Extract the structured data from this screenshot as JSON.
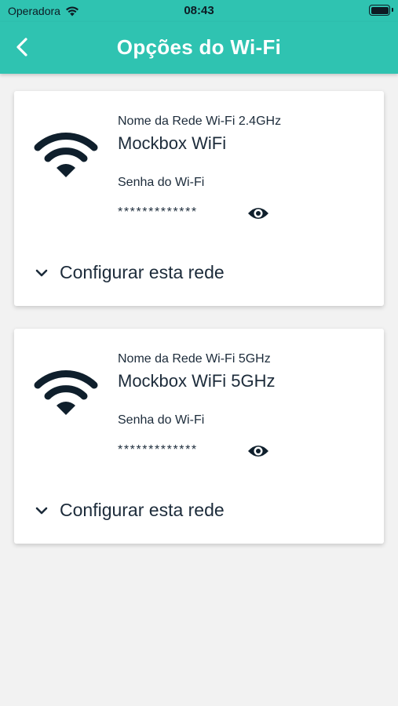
{
  "status_bar": {
    "carrier": "Operadora",
    "time": "08:43",
    "icons": [
      "wifi-icon",
      "battery-icon"
    ]
  },
  "nav": {
    "back_icon": "chevron-left-icon",
    "title": "Opções do Wi-Fi"
  },
  "colors": {
    "primary": "#2fc3b1",
    "text": "#1c2b3a",
    "background": "#f2f2f2",
    "card": "#ffffff"
  },
  "networks": [
    {
      "icon": "wifi-icon",
      "name_label": "Nome da Rede Wi-Fi 2.4GHz",
      "name": "Mockbox WiFi",
      "password_label": "Senha do Wi-Fi",
      "password": "*************",
      "reveal_icon": "eye-icon",
      "configure_label": "Configurar esta rede",
      "configure_icon": "chevron-down-icon"
    },
    {
      "icon": "wifi-icon",
      "name_label": "Nome da Rede Wi-Fi 5GHz",
      "name": "Mockbox WiFi 5GHz",
      "password_label": "Senha do Wi-Fi",
      "password": "*************",
      "reveal_icon": "eye-icon",
      "configure_label": "Configurar esta rede",
      "configure_icon": "chevron-down-icon"
    }
  ]
}
